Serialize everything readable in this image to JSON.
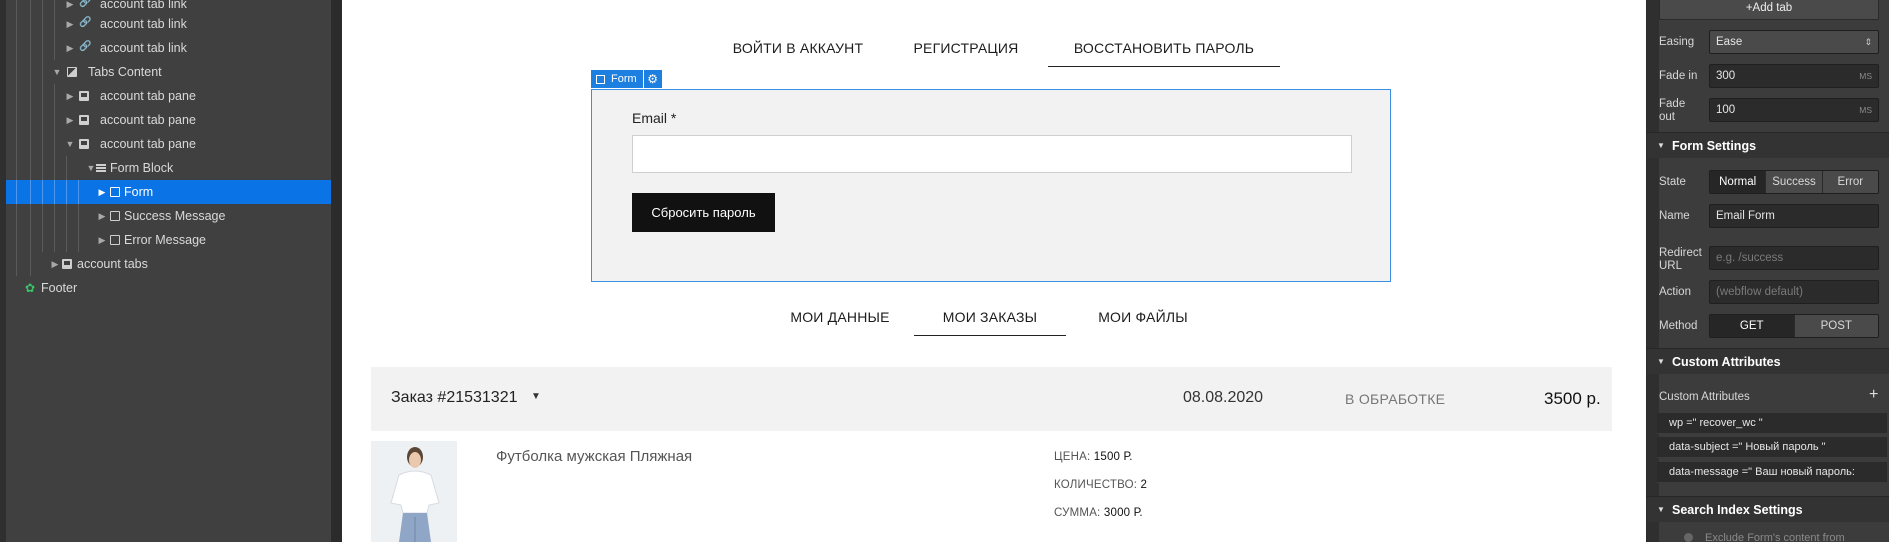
{
  "navigator": {
    "items": [
      {
        "label": "account tab link",
        "icon": "link-icon"
      },
      {
        "label": "account tab link",
        "icon": "link-icon"
      },
      {
        "label": "account tab link",
        "icon": "link-icon"
      },
      {
        "label": "Tabs Content",
        "icon": "tabs-content-icon"
      },
      {
        "label": "account tab pane",
        "icon": "tab-pane-icon"
      },
      {
        "label": "account tab pane",
        "icon": "tab-pane-icon"
      },
      {
        "label": "account tab pane",
        "icon": "tab-pane-icon"
      },
      {
        "label": "Form Block",
        "icon": "form-block-icon"
      },
      {
        "label": "Form",
        "icon": "form-icon"
      },
      {
        "label": "Success Message",
        "icon": "box-icon"
      },
      {
        "label": "Error Message",
        "icon": "box-icon"
      },
      {
        "label": "account tabs",
        "icon": "tabs-icon"
      },
      {
        "label": "Footer",
        "icon": "symbol-icon"
      }
    ]
  },
  "canvas": {
    "auth_tabs": [
      "ВОЙТИ В АККАУНТ",
      "РЕГИСТРАЦИЯ",
      "ВОССТАНОВИТЬ ПАРОЛЬ"
    ],
    "form_badge": "Form",
    "email_label": "Email *",
    "email_value": "",
    "reset_button": "Сбросить пароль",
    "account_tabs": [
      "МОИ ДАННЫЕ",
      "МОИ ЗАКАЗЫ",
      "МОИ ФАЙЛЫ"
    ],
    "order": {
      "title": "Заказ #21531321",
      "date": "08.08.2020",
      "status": "В ОБРАБОТКЕ",
      "total": "3500 р."
    },
    "product": {
      "name": "Футболка мужская Пляжная",
      "price_label": "ЦЕНА:",
      "price_value": "1500 Р.",
      "qty_label": "КОЛИЧЕСТВО:",
      "qty_value": "2",
      "sum_label": "СУММА:",
      "sum_value": "3000 Р."
    }
  },
  "settings": {
    "add_tab": "Add tab",
    "easing_label": "Easing",
    "easing_value": "Ease",
    "fade_in_label": "Fade in",
    "fade_in_value": "300",
    "fade_out_label": "Fade out",
    "fade_out_value": "100",
    "unit": "MS",
    "form_settings_title": "Form Settings",
    "state_label": "State",
    "state_options": [
      "Normal",
      "Success",
      "Error"
    ],
    "name_label": "Name",
    "name_value": "Email Form",
    "redirect_label": "Redirect URL",
    "redirect_placeholder": "e.g. /success",
    "action_label": "Action",
    "action_placeholder": "(webflow default)",
    "method_label": "Method",
    "method_options": [
      "GET",
      "POST"
    ],
    "custom_attributes_title": "Custom Attributes",
    "custom_attributes_label": "Custom Attributes",
    "attributes": [
      "wp =\" recover_wc \"",
      "data-subject =\" Новый пароль \"",
      "data-message =\" Ваш новый пароль:"
    ],
    "search_index_title": "Search Index Settings",
    "search_index_text": "Exclude Form's content from"
  },
  "colors": {
    "selection": "#0a73e6",
    "form_outline": "#3a8ee6",
    "symbol": "#39c36a"
  }
}
